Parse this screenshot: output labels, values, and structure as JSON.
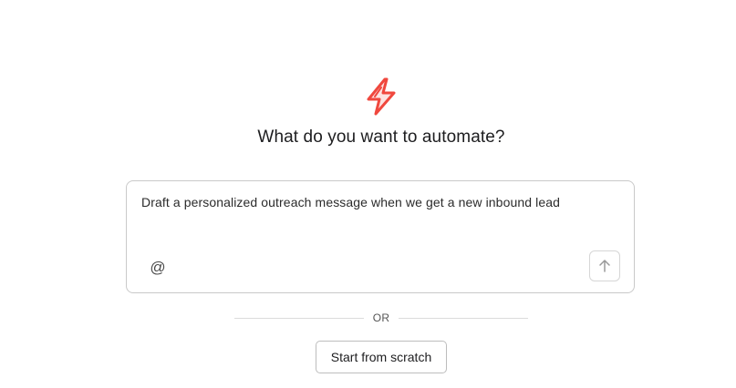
{
  "logo": {
    "icon": "lightning-bolt-icon",
    "color": "#f0483e"
  },
  "heading": "What do you want to automate?",
  "prompt": {
    "value": "Draft a personalized outreach message when we get a new inbound lead",
    "mention_icon": "at-sign-icon",
    "mention_symbol": "@",
    "send_icon": "arrow-up-icon"
  },
  "divider": {
    "label": "OR"
  },
  "actions": {
    "start_from_scratch": "Start from scratch"
  }
}
